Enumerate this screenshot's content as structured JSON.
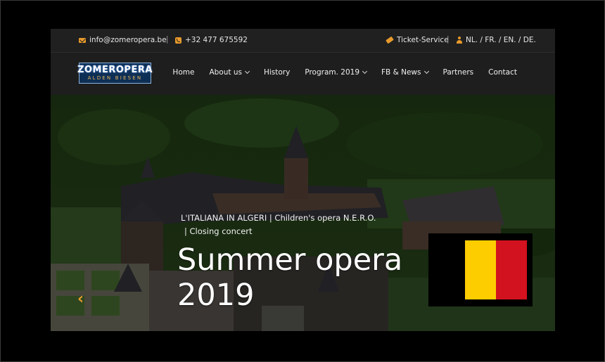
{
  "topbar": {
    "email": "info@zomeropera.be",
    "phone": "+32 477 675592",
    "ticket": "Ticket-Service",
    "languages": "NL. / FR. / EN. / DE.",
    "separator": "|"
  },
  "logo": {
    "main": "ZOMEROPERA",
    "sub": "ALDEN BIESEN"
  },
  "nav": [
    {
      "label": "Home",
      "dropdown": false
    },
    {
      "label": "About us",
      "dropdown": true
    },
    {
      "label": "History",
      "dropdown": false
    },
    {
      "label": "Program. 2019",
      "dropdown": true
    },
    {
      "label": "FB & News",
      "dropdown": true
    },
    {
      "label": "Partners",
      "dropdown": false
    },
    {
      "label": "Contact",
      "dropdown": false
    }
  ],
  "hero": {
    "tagline_line1": "L'ITALIANA IN ALGERI  | Children's opera N.E.R.O.",
    "tagline_line2": "| Closing concert",
    "title_line1": "Summer opera",
    "title_line2": "2019",
    "prev_arrow": "‹"
  },
  "colors": {
    "accent": "#e89a2c",
    "topbar_bg": "#202020",
    "nav_bg": "#1e1e1e",
    "flag_black": "#000000",
    "flag_yellow": "#fdcd00",
    "flag_red": "#d2121e"
  },
  "icons": {
    "email": "mail-icon",
    "phone": "phone-icon",
    "ticket": "ticket-icon",
    "language": "user-icon",
    "prev": "chevron-left-icon"
  }
}
